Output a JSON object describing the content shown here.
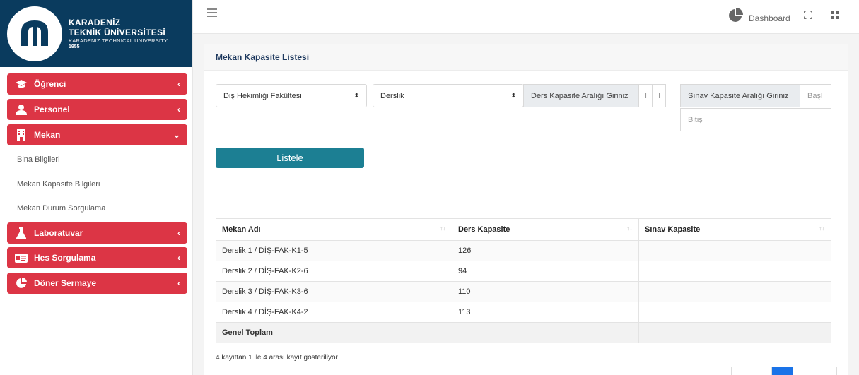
{
  "logo": {
    "line1": "KARADENİZ",
    "line2": "TEKNİK ÜNİVERSİTESİ",
    "line3": "KARADENIZ TECHNICAL UNIVERSITY",
    "line4": "1955"
  },
  "sidebar": {
    "items": [
      {
        "label": "Öğrenci",
        "icon": "graduation-cap-icon"
      },
      {
        "label": "Personel",
        "icon": "users-icon"
      },
      {
        "label": "Mekan",
        "icon": "building-icon"
      },
      {
        "label": "Laboratuvar",
        "icon": "flask-icon"
      },
      {
        "label": "Hes Sorgulama",
        "icon": "id-card-icon"
      },
      {
        "label": "Döner Sermaye",
        "icon": "pie-chart-icon"
      }
    ],
    "mekan_sub": [
      "Bina Bilgileri",
      "Mekan Kapasite Bilgileri",
      "Mekan Durum Sorgulama"
    ]
  },
  "topbar": {
    "dashboard_label": "Dashboard"
  },
  "panel": {
    "title": "Mekan Kapasite Listesi"
  },
  "filters": {
    "faculty": "Diş Hekimliği Fakültesi",
    "type": "Derslik",
    "ders_addon": "Ders Kapasite Aralığı Giriniz",
    "sinav_addon": "Sınav Kapasite Aralığı Giriniz",
    "sinav_start_placeholder": "Başl",
    "sinav_end_placeholder": "Bitiş",
    "list_button": "Listele"
  },
  "table": {
    "headers": [
      "Mekan Adı",
      "Ders Kapasite",
      "Sınav Kapasite"
    ],
    "rows": [
      [
        "Derslik 1 / DİŞ-FAK-K1-5",
        "126",
        ""
      ],
      [
        "Derslik 2 / DİŞ-FAK-K2-6",
        "94",
        ""
      ],
      [
        "Derslik 3 / DİŞ-FAK-K3-6",
        "110",
        ""
      ],
      [
        "Derslik 4 / DİŞ-FAK-K4-2",
        "113",
        ""
      ]
    ],
    "footer_label": "Genel Toplam"
  },
  "info_text": "4 kayıttan 1 ile 4 arası kayıt gösteriliyor",
  "colors": {
    "brand": "#0a3b5e",
    "menu": "#dc3545",
    "button": "#1c7f93",
    "page_active": "#1a73e8"
  }
}
